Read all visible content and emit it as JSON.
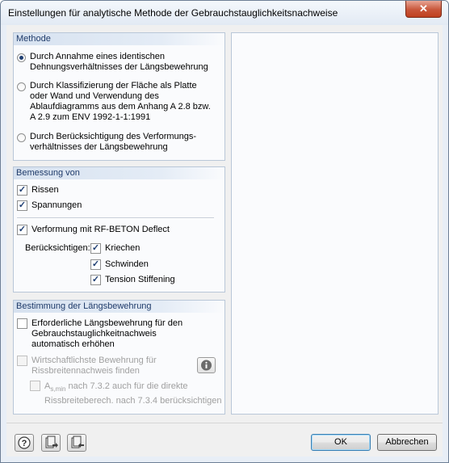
{
  "window": {
    "title": "Einstellungen für analytische Methode der Gebrauchstauglichkeitsnachweise",
    "close_glyph": "✕"
  },
  "methode": {
    "title": "Methode",
    "options": [
      {
        "lines": [
          "Durch Annahme eines identischen",
          "Dehnungsverhältnisses der Längsbewehrung"
        ],
        "selected": true
      },
      {
        "lines": [
          "Durch Klassifizierung der Fläche als Platte",
          "oder Wand und Verwendung des",
          "Ablaufdiagramms aus dem Anhang A 2.8 bzw.",
          "A 2.9 zum ENV 1992-1-1:1991"
        ],
        "selected": false
      },
      {
        "lines": [
          "Durch Berücksichtigung des Verformungs-",
          "verhältnisses der Längsbewehrung"
        ],
        "selected": false
      }
    ]
  },
  "bemessung": {
    "title": "Bemessung von",
    "rissen": {
      "label": "Rissen",
      "checked": true
    },
    "spannungen": {
      "label": "Spannungen",
      "checked": true
    },
    "verformung": {
      "label": "Verformung mit RF-BETON Deflect",
      "checked": true
    },
    "beruecksichtigen_label": "Berücksichtigen:",
    "kriechen": {
      "label": "Kriechen",
      "checked": true
    },
    "schwinden": {
      "label": "Schwinden",
      "checked": true
    },
    "tension": {
      "label": "Tension Stiffening",
      "checked": true
    }
  },
  "laengs": {
    "title": "Bestimmung der Längsbewehrung",
    "erhoehen": {
      "lines": [
        "Erforderliche Längsbewehrung für den",
        "Gebrauchstauglichkeitnachweis",
        "automatisch erhöhen"
      ],
      "checked": false
    },
    "wirtschaftlich": {
      "lines": [
        "Wirtschaftlichste Bewehrung für",
        "Rissbreitennachweis finden"
      ],
      "checked": false,
      "enabled": false
    },
    "asmin": {
      "symbol": "A",
      "subscript": "s,min",
      "line1_rest": "nach 7.3.2 auch für die direkte",
      "line2": "Rissbreiteberech. nach 7.3.4 berücksichtigen",
      "checked": false,
      "enabled": false
    }
  },
  "buttons": {
    "ok": "OK",
    "cancel": "Abbrechen"
  },
  "icons": [
    "help-icon",
    "load-defaults-icon",
    "save-defaults-icon",
    "info-icon"
  ]
}
